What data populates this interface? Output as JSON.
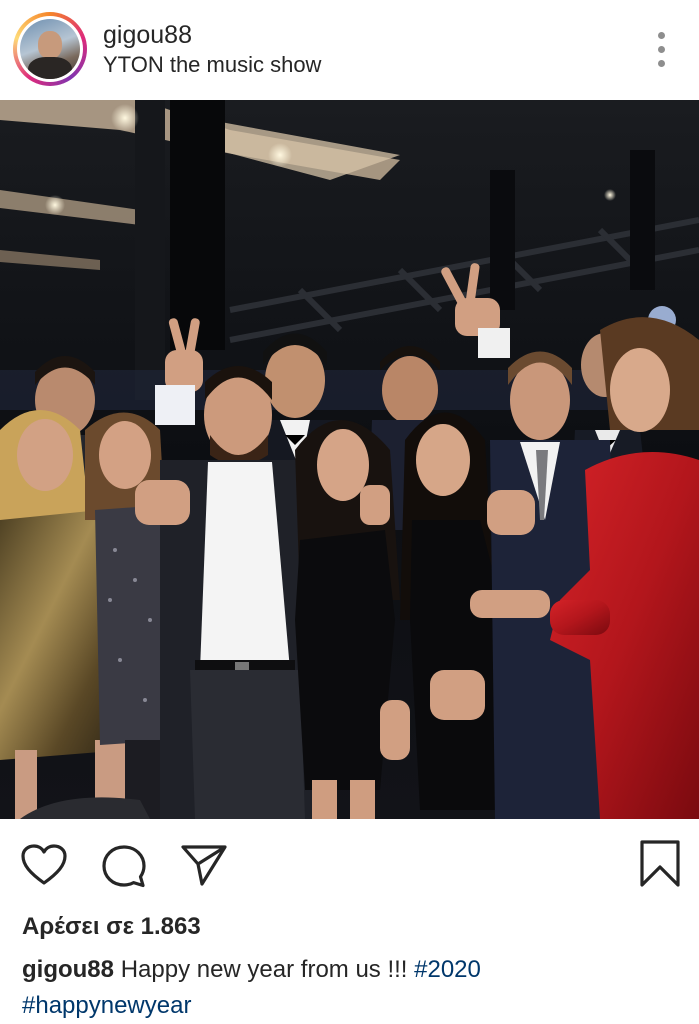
{
  "post": {
    "username": "gigou88",
    "location": "YTON the music show",
    "likes_text": "Αρέσει σε 1.863",
    "caption": {
      "username": "gigou88",
      "text": "Happy new year from us !!!",
      "hashtags": [
        "#2020",
        "#happynewyear"
      ]
    }
  },
  "icons": {
    "more": "more-options-icon",
    "like": "heart-icon",
    "comment": "comment-bubble-icon",
    "share": "paper-plane-icon",
    "save": "bookmark-icon"
  },
  "colors": {
    "text": "#262626",
    "hashtag": "#00376b",
    "icon_stroke": "#262626"
  }
}
